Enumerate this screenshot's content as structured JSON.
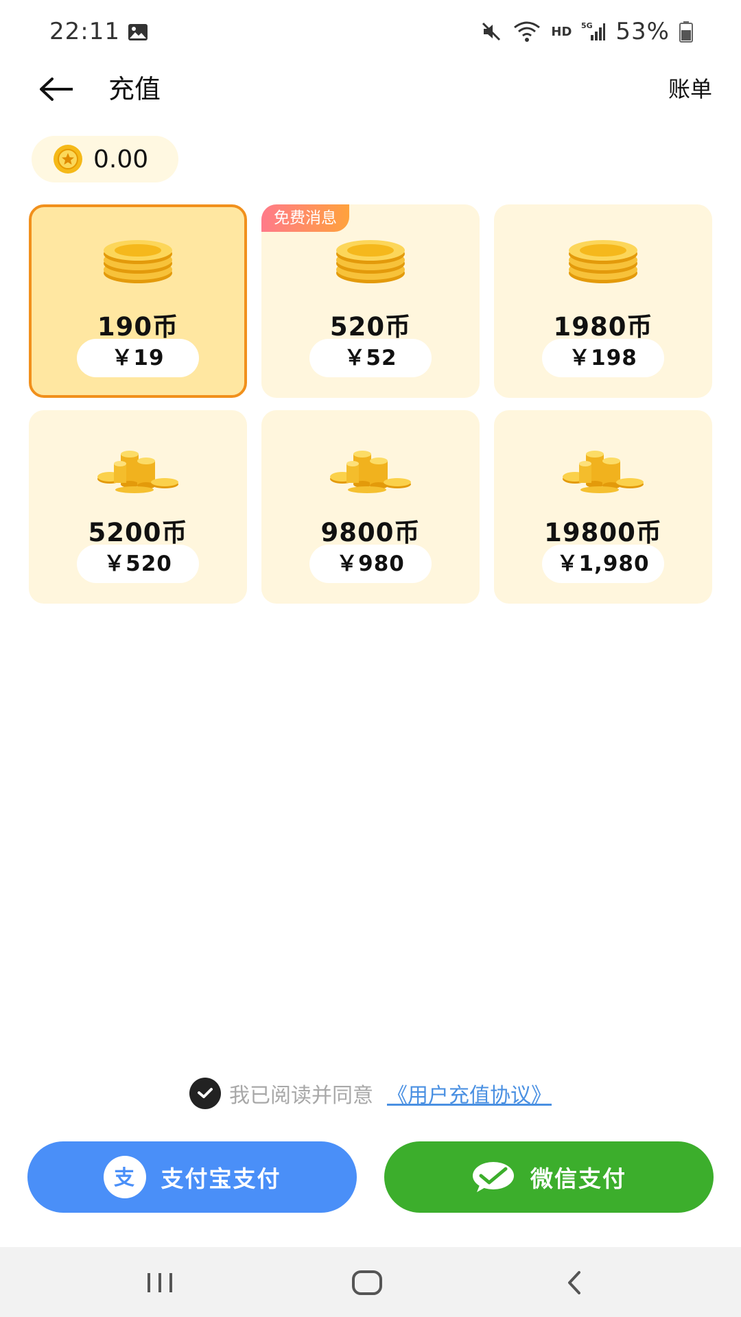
{
  "status_bar": {
    "time": "22:11",
    "network": "HD",
    "battery": "53%"
  },
  "header": {
    "title": "充值",
    "bill_label": "账单"
  },
  "balance": {
    "value": "0.00"
  },
  "packages": [
    {
      "coins": "190币",
      "price": "￥19",
      "selected": true,
      "icon": "coin-stack-icon"
    },
    {
      "coins": "520币",
      "price": "￥52",
      "badge": "免费消息",
      "icon": "coin-stack-icon"
    },
    {
      "coins": "1980币",
      "price": "￥198",
      "icon": "coin-stack-icon"
    },
    {
      "coins": "5200币",
      "price": "￥520",
      "icon": "coin-pile-icon"
    },
    {
      "coins": "9800币",
      "price": "￥980",
      "icon": "coin-pile-icon"
    },
    {
      "coins": "19800币",
      "price": "￥1,980",
      "icon": "coin-pile-icon"
    }
  ],
  "agreement": {
    "text": "我已阅读并同意",
    "link": "《用户充值协议》",
    "checked": true
  },
  "payment": {
    "alipay_label": "支付宝支付",
    "wechat_label": "微信支付"
  },
  "colors": {
    "selected_border": "#f1901c",
    "alipay": "#4a8ff8",
    "wechat": "#3cae2c"
  }
}
